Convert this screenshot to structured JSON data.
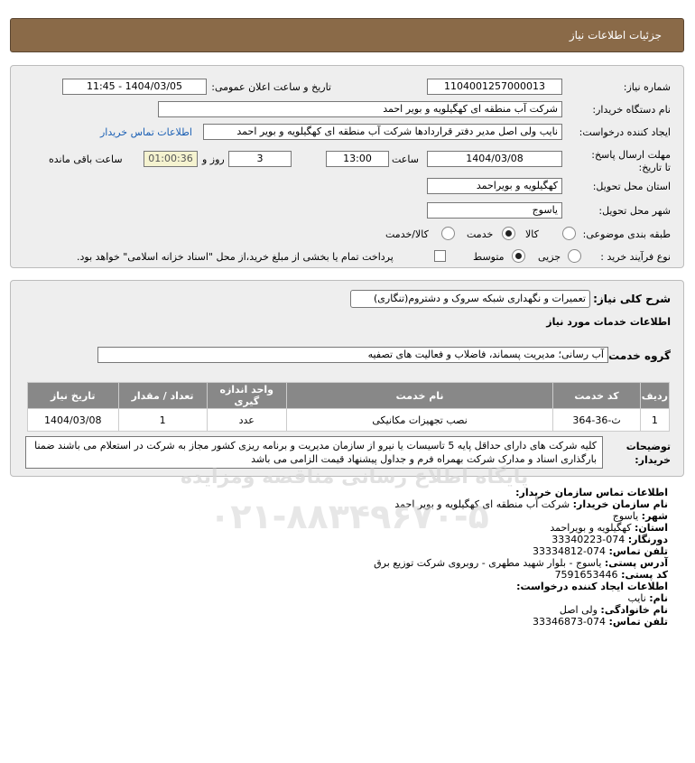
{
  "header": {
    "title": "جزئیات اطلاعات نیاز"
  },
  "form": {
    "need_no_label": "شماره نیاز:",
    "need_no": "1104001257000013",
    "announce_label": "تاریخ و ساعت اعلان عمومی:",
    "announce_value": "1404/03/05 - 11:45",
    "buyer_label": "نام دستگاه خریدار:",
    "buyer_value": "شرکت آب منطقه ای کهگیلویه و بویر احمد",
    "creator_label": "ایجاد کننده درخواست:",
    "creator_value": "نایب ولی اصل مدیر دفتر قراردادها شرکت آب منطقه ای کهگیلویه و بویر احمد",
    "contact_link": "اطلاعات تماس خریدار",
    "deadline_label": "مهلت ارسال پاسخ: تا تاریخ:",
    "deadline_date": "1404/03/08",
    "time_label": "ساعت",
    "deadline_time": "13:00",
    "days_value": "3",
    "days_label": "روز و",
    "remaining_value": "01:00:36",
    "remaining_label": "ساعت باقی مانده",
    "province_label": "استان محل تحویل:",
    "province_value": "کهگیلویه و بویراحمد",
    "city_label": "شهر محل تحویل:",
    "city_value": "یاسوج",
    "category_label": "طبقه بندی موضوعی:",
    "category_options": [
      "کالا",
      "خدمت",
      "کالا/خدمت"
    ],
    "process_label": "نوع فرآیند خرید :",
    "process_options": [
      "جزیی",
      "متوسط"
    ],
    "treasury_text": "پرداخت تمام یا بخشی از مبلغ خرید،از محل \"اسناد خزانه اسلامی\" خواهد بود."
  },
  "details": {
    "summary_label": "شرح کلی نیاز:",
    "summary_value": "تعمیرات و نگهداری شبکه سروک و دشتروم(تنگاری)",
    "services_title": "اطلاعات خدمات مورد نیاز",
    "service_group_label": "گروه خدمت:",
    "service_group_value": "آب رسانی؛ مدیریت پسماند، فاضلاب و فعالیت های تصفیه",
    "table": {
      "headers": [
        "ردیف",
        "کد خدمت",
        "نام خدمت",
        "واحد اندازه گیری",
        "تعداد / مقدار",
        "تاریخ نیاز"
      ],
      "rows": [
        [
          "1",
          "ث-36-364",
          "نصب تجهیزات مکانیکی",
          "عدد",
          "1",
          "1404/03/08"
        ]
      ]
    },
    "notes_label": "توضیحات خریدار:",
    "notes_value": "کلیه شرکت های دارای حداقل پایه 5 تاسیسات یا نیرو از سازمان مدیریت و برنامه ریزی کشور مجاز به شرکت در استعلام می باشند ضمنا بارگذاری اسناد و مدارک شرکت بهمراه فرم و جداول پیشنهاد قیمت الزامی می باشد"
  },
  "contact": {
    "org_title": "اطلاعات تماس سازمان خریدار:",
    "org_name_label": "نام سازمان خریدار:",
    "org_name": "شرکت آب منطقه ای کهگیلویه و بویر احمد",
    "city_label": "شهر:",
    "city": "یاسوج",
    "province_label": "استان:",
    "province": "کهگیلویه و بویراحمد",
    "fax_label": "دورنگار:",
    "fax": "074-33340223",
    "phone_label": "تلفن تماس:",
    "phone": "074-33334812",
    "address_label": "آدرس پستی:",
    "address": "یاسوج - بلوار شهید مطهری - روبروی شرکت توزیع برق",
    "postal_label": "کد پستی:",
    "postal": "7591653446",
    "creator_title": "اطلاعات ایجاد کننده درخواست:",
    "first_name_label": "نام:",
    "first_name": "نایب",
    "last_name_label": "نام خانوادگی:",
    "last_name": "ولی اصل",
    "creator_phone_label": "تلفن تماس:",
    "creator_phone": "074-33346873"
  },
  "watermark": {
    "line1": "پایگاه اطلاع رسانی مناقصه ومزایده",
    "line2": "۰۲۱-۸۸۳۴۹۶۷۰-۵"
  }
}
